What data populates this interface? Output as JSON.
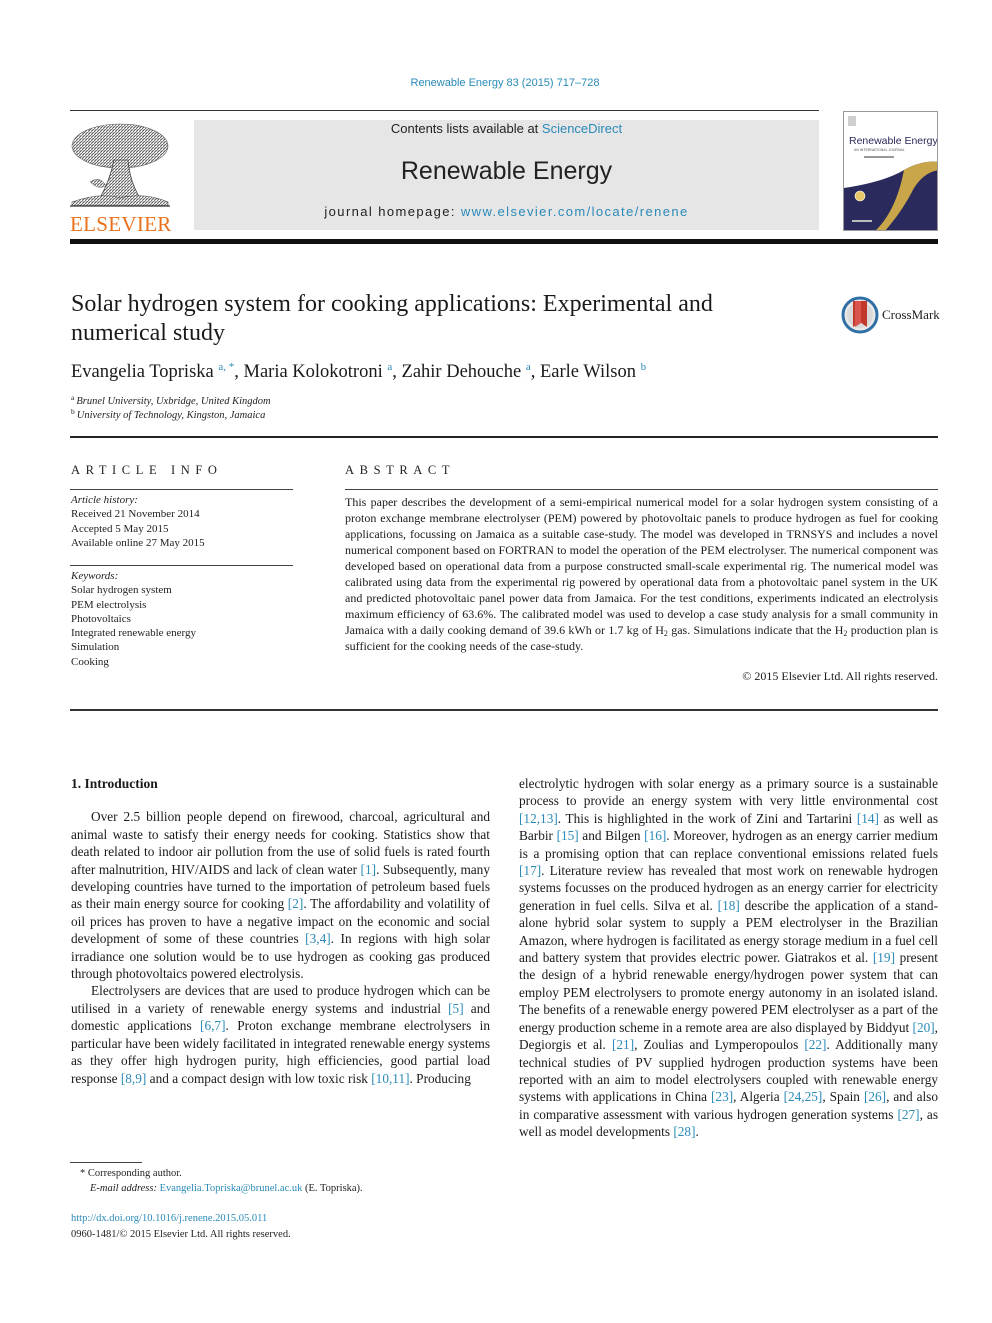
{
  "header": {
    "journal_ref": "Renewable Energy 83 (2015) 717–728",
    "publisher": "ELSEVIER",
    "contents_prefix": "Contents lists available at ",
    "contents_link": "ScienceDirect",
    "journal_title": "Renewable Energy",
    "homepage_prefix": "journal homepage: ",
    "homepage_link": "www.elsevier.com/locate/renene",
    "cover": {
      "title": "Renewable Energy",
      "subtitle": "AN INTERNATIONAL JOURNAL"
    },
    "colors": {
      "link": "#2a8ab8",
      "elsevier_orange": "#e9711c",
      "masthead_bg": "#e6e6e6",
      "cover_navy": "#2b2a5c",
      "cover_gold": "#c9a64a"
    }
  },
  "article": {
    "title": "Solar hydrogen system for cooking applications: Experimental and numerical study",
    "crossmark_label": "CrossMark",
    "authors": [
      {
        "name": "Evangelia Topriska",
        "sup": "a, *"
      },
      {
        "name": "Maria Kolokotroni",
        "sup": "a"
      },
      {
        "name": "Zahir Dehouche",
        "sup": "a"
      },
      {
        "name": "Earle Wilson",
        "sup": "b"
      }
    ],
    "affiliations": [
      {
        "key": "a",
        "text": "Brunel University, Uxbridge, United Kingdom"
      },
      {
        "key": "b",
        "text": "University of Technology, Kingston, Jamaica"
      }
    ]
  },
  "article_info": {
    "heading": "ARTICLE INFO",
    "history_heading": "Article history:",
    "history": [
      "Received 21 November 2014",
      "Accepted 5 May 2015",
      "Available online 27 May 2015"
    ],
    "keywords_heading": "Keywords:",
    "keywords": [
      "Solar hydrogen system",
      "PEM electrolysis",
      "Photovoltaics",
      "Integrated renewable energy",
      "Simulation",
      "Cooking"
    ]
  },
  "abstract": {
    "heading": "ABSTRACT",
    "part1": "This paper describes the development of a semi-empirical numerical model for a solar hydrogen system consisting of a proton exchange membrane electrolyser (PEM) powered by photovoltaic panels to produce hydrogen as fuel for cooking applications, focussing on Jamaica as a suitable case-study. The model was developed in TRNSYS and includes a novel numerical component based on FORTRAN to model the operation of the PEM electrolyser. The numerical component was developed based on operational data from a purpose constructed small-scale experimental rig. The numerical model was calibrated using data from the experimental rig powered by operational data from a photovoltaic panel system in the UK and predicted photovoltaic panel power data from Jamaica. For the test conditions, experiments indicated an electrolysis maximum efficiency of 63.6%. The calibrated model was used to develop a case study analysis for a small community in Jamaica with a daily cooking demand of 39.6 kWh or 1.7 kg of H",
    "sub1": "2",
    "part2": " gas. Simulations indicate that the H",
    "sub2": "2",
    "part3": " production plan is sufficient for the cooking needs of the case-study.",
    "copyright": "© 2015 Elsevier Ltd. All rights reserved."
  },
  "body": {
    "section_heading": "1.  Introduction",
    "p1": [
      {
        "t": "Over 2.5 billion people depend on firewood, charcoal, agricultural and animal waste to satisfy their energy needs for cooking. Statistics show that death related to indoor air pollution from the use of solid fuels is rated fourth after malnutrition, HIV/AIDS and lack of clean water "
      },
      {
        "ref": "[1]"
      },
      {
        "t": ". Subsequently, many developing countries have turned to the importation of petroleum based fuels as their main energy source for cooking "
      },
      {
        "ref": "[2]"
      },
      {
        "t": ". The affordability and volatility of oil prices has proven to have a negative impact on the economic and social development of some of these countries "
      },
      {
        "ref": "[3,4]"
      },
      {
        "t": ". In regions with high solar irradiance one solution would be to use hydrogen as cooking gas produced through photovoltaics powered electrolysis."
      }
    ],
    "p2": [
      {
        "t": "Electrolysers are devices that are used to produce hydrogen which can be utilised in a variety of renewable energy systems and industrial "
      },
      {
        "ref": "[5]"
      },
      {
        "t": " and domestic applications "
      },
      {
        "ref": "[6,7]"
      },
      {
        "t": ". Proton exchange membrane electrolysers in particular have been widely facilitated in integrated renewable energy systems as they offer high hydrogen purity, high efficiencies, good partial load response "
      },
      {
        "ref": "[8,9]"
      },
      {
        "t": " and a compact design with low toxic risk "
      },
      {
        "ref": "[10,11]"
      },
      {
        "t": ". Producing electrolytic hydrogen with solar energy as a primary source is a sustainable process to provide an energy system with very little environmental cost "
      },
      {
        "ref": "[12,13]"
      },
      {
        "t": ". This is highlighted in the work of Zini and Tartarini "
      },
      {
        "ref": "[14]"
      },
      {
        "t": " as well as Barbir "
      },
      {
        "ref": "[15]"
      },
      {
        "t": " and Bilgen "
      },
      {
        "ref": "[16]"
      },
      {
        "t": ". Moreover, hydrogen as an energy carrier medium is a promising option that can replace conventional emissions related fuels "
      },
      {
        "ref": "[17]"
      },
      {
        "t": ". Literature review has revealed that most work on renewable hydrogen systems focusses on the produced hydrogen as an energy carrier for electricity generation in fuel cells. Silva et al. "
      },
      {
        "ref": "[18]"
      },
      {
        "t": " describe the application of a stand-alone hybrid solar system to supply a PEM electrolyser in the Brazilian Amazon, where hydrogen is facilitated as energy storage medium in a fuel cell and battery system that provides electric power. Giatrakos et al. "
      },
      {
        "ref": "[19]"
      },
      {
        "t": " present the design of a hybrid renewable energy/hydrogen power system that can employ PEM electrolysers to promote energy autonomy in an isolated island. The benefits of a renewable energy powered PEM electrolyser as a part of the energy production scheme in a remote area are also displayed by Biddyut "
      },
      {
        "ref": "[20]"
      },
      {
        "t": ", Degiorgis et al. "
      },
      {
        "ref": "[21]"
      },
      {
        "t": ", Zoulias and Lymperopoulos "
      },
      {
        "ref": "[22]"
      },
      {
        "t": ". Additionally many technical studies of PV supplied hydrogen production systems have been reported with an aim to model electrolysers coupled with renewable energy systems with applications in China "
      },
      {
        "ref": "[23]"
      },
      {
        "t": ", Algeria "
      },
      {
        "ref": "[24,25]"
      },
      {
        "t": ", Spain "
      },
      {
        "ref": "[26]"
      },
      {
        "t": ", and also in comparative assessment with various hydrogen generation systems "
      },
      {
        "ref": "[27]"
      },
      {
        "t": ", as well as model developments "
      },
      {
        "ref": "[28]"
      },
      {
        "t": "."
      }
    ]
  },
  "footnotes": {
    "corresponding": "* Corresponding author.",
    "email_label": "E-mail address:",
    "email": "Evangelia.Topriska@brunel.ac.uk",
    "email_suffix": " (E. Topriska).",
    "doi": "http://dx.doi.org/10.1016/j.renene.2015.05.011",
    "issn": "0960-1481/© 2015 Elsevier Ltd. All rights reserved."
  }
}
